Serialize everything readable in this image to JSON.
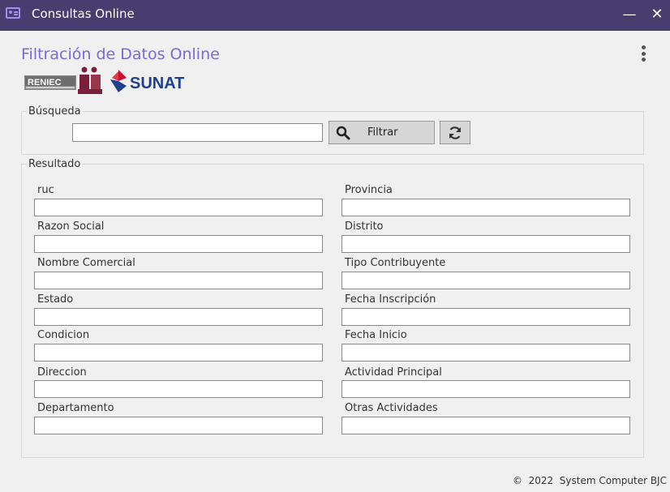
{
  "window": {
    "title": "Consultas Online",
    "minimize": "—",
    "close": "✕"
  },
  "page": {
    "title": "Filtración de Datos Online"
  },
  "logos": {
    "reniec": "RENIEC",
    "sunat": "SUNAT"
  },
  "search": {
    "legend": "Búsqueda",
    "value": "",
    "filter_label": "Filtrar"
  },
  "result": {
    "legend": "Resultado",
    "left": [
      "ruc",
      "Razon Social",
      "Nombre Comercial",
      "Estado",
      "Condicion",
      "Direccion",
      "Departamento"
    ],
    "right": [
      "Provincia",
      "Distrito",
      "Tipo Contribuyente",
      "Fecha Inscripción",
      "Fecha Inicio",
      "Actividad Principal",
      "Otras Actividades"
    ]
  },
  "footer": {
    "text": "©  2022  System Computer BJC"
  },
  "colors": {
    "titlebar": "#473e6f",
    "accent": "#7b6ad6",
    "sunat_red": "#c8102e",
    "sunat_blue": "#1f3f8f"
  }
}
